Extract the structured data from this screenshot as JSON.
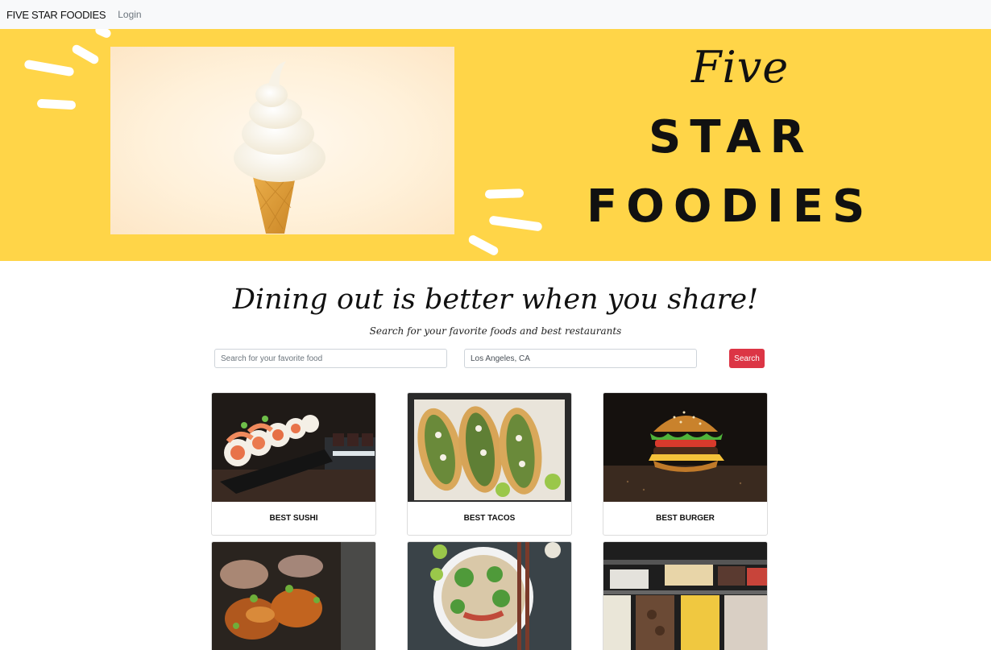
{
  "navbar": {
    "brand": "FIVE STAR FOODIES",
    "login": "Login"
  },
  "hero": {
    "script_word": "Five",
    "line1": "STAR",
    "line2": "FOODIES",
    "background_color": "#ffd548"
  },
  "intro": {
    "headline": "Dining out is better when you share!",
    "subline": "Search for your favorite foods and best restaurants"
  },
  "search": {
    "food_placeholder": "Search for your favorite food",
    "location_value": "Los Angeles, CA",
    "button_label": "Search",
    "button_color": "#dc3545"
  },
  "cards": [
    {
      "title": "BEST SUSHI",
      "image": "sushi-photo"
    },
    {
      "title": "BEST TACOS",
      "image": "tacos-photo"
    },
    {
      "title": "BEST BURGER",
      "image": "burger-photo"
    },
    {
      "title": "",
      "image": "kebab-photo"
    },
    {
      "title": "",
      "image": "pho-photo"
    },
    {
      "title": "",
      "image": "gelato-photo"
    }
  ]
}
